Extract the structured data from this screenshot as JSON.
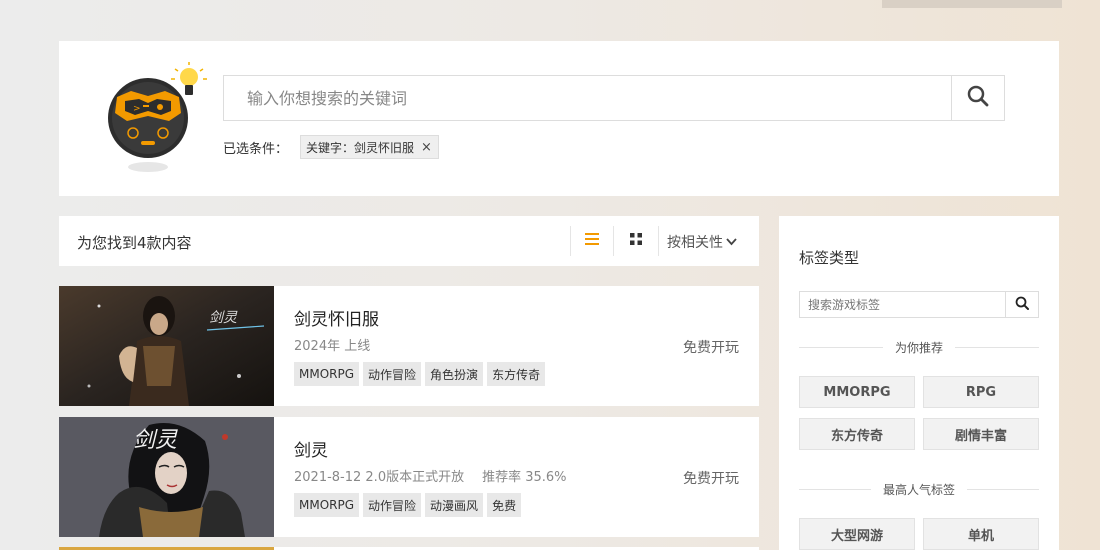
{
  "search": {
    "placeholder": "输入你想搜索的关键词",
    "conditions_label": "已选条件：",
    "chip_label": "关键字：剑灵怀旧服",
    "chip_close": "×"
  },
  "results": {
    "count_text": "为您找到4款内容",
    "sort_label": "按相关性"
  },
  "games": [
    {
      "title": "剑灵怀旧服",
      "meta": [
        "2024年 上线"
      ],
      "status": "免费开玩",
      "tags": [
        "MMORPG",
        "动作冒险",
        "角色扮演",
        "东方传奇"
      ]
    },
    {
      "title": "剑灵",
      "meta": [
        "2021-8-12 2.0版本正式开放",
        "推荐率 35.6%"
      ],
      "status": "免费开玩",
      "tags": [
        "MMORPG",
        "动作冒险",
        "动漫画风",
        "免费"
      ]
    }
  ],
  "sidebar": {
    "title": "标签类型",
    "search_placeholder": "搜索游戏标签",
    "recommend_heading": "为你推荐",
    "recommend_tags": [
      "MMORPG",
      "RPG",
      "东方传奇",
      "剧情丰富"
    ],
    "popular_heading": "最高人气标签",
    "popular_tags": [
      "大型网游",
      "单机"
    ]
  },
  "colors": {
    "accent": "#f39a00",
    "panel": "#ffffff",
    "tag_bg": "#e8e8e8"
  },
  "icons": {
    "search": "magnifier",
    "list_view": "list-icon",
    "grid_view": "grid-icon",
    "sort": "chevron-down-icon"
  }
}
